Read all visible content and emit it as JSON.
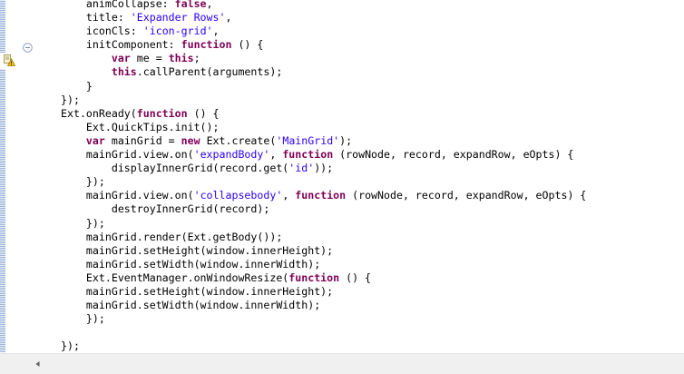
{
  "editor": {
    "lines": [
      [
        {
          "t": "    animCollapse: "
        },
        {
          "t": "false",
          "c": "kw"
        },
        {
          "t": ","
        }
      ],
      [
        {
          "t": "    title: "
        },
        {
          "t": "'Expander Rows'",
          "c": "str"
        },
        {
          "t": ","
        }
      ],
      [
        {
          "t": "    iconCls: "
        },
        {
          "t": "'icon-grid'",
          "c": "str"
        },
        {
          "t": ","
        }
      ],
      [
        {
          "t": "    initComponent: "
        },
        {
          "t": "function",
          "c": "kw"
        },
        {
          "t": " () {"
        }
      ],
      [
        {
          "t": "        "
        },
        {
          "t": "var",
          "c": "kw"
        },
        {
          "t": " me = "
        },
        {
          "t": "this",
          "c": "kw"
        },
        {
          "t": ";"
        }
      ],
      [
        {
          "t": "        "
        },
        {
          "t": "this",
          "c": "kw"
        },
        {
          "t": ".callParent(arguments);"
        }
      ],
      [
        {
          "t": "    }"
        }
      ],
      [
        {
          "t": "});"
        }
      ],
      [
        {
          "t": "Ext.onReady("
        },
        {
          "t": "function",
          "c": "kw"
        },
        {
          "t": " () {"
        }
      ],
      [
        {
          "t": "    Ext.QuickTips.init();"
        }
      ],
      [
        {
          "t": "    "
        },
        {
          "t": "var",
          "c": "kw"
        },
        {
          "t": " mainGrid = "
        },
        {
          "t": "new",
          "c": "kw"
        },
        {
          "t": " Ext.create("
        },
        {
          "t": "'MainGrid'",
          "c": "str"
        },
        {
          "t": ");"
        }
      ],
      [
        {
          "t": "    mainGrid.view.on("
        },
        {
          "t": "'expandBody'",
          "c": "str"
        },
        {
          "t": ", "
        },
        {
          "t": "function",
          "c": "kw"
        },
        {
          "t": " (rowNode, record, expandRow, eOpts) {"
        }
      ],
      [
        {
          "t": "        displayInnerGrid(record.get("
        },
        {
          "t": "'id'",
          "c": "str"
        },
        {
          "t": "));"
        }
      ],
      [
        {
          "t": "    });"
        }
      ],
      [
        {
          "t": "    mainGrid.view.on("
        },
        {
          "t": "'collapsebody'",
          "c": "str"
        },
        {
          "t": ", "
        },
        {
          "t": "function",
          "c": "kw"
        },
        {
          "t": " (rowNode, record, expandRow, eOpts) {"
        }
      ],
      [
        {
          "t": "        destroyInnerGrid(record);"
        }
      ],
      [
        {
          "t": "    });"
        }
      ],
      [
        {
          "t": "    mainGrid.render(Ext.getBody());"
        }
      ],
      [
        {
          "t": "    mainGrid.setHeight(window.innerHeight);"
        }
      ],
      [
        {
          "t": "    mainGrid.setWidth(window.innerWidth);"
        }
      ],
      [
        {
          "t": "    Ext.EventManager.onWindowResize("
        },
        {
          "t": "function",
          "c": "kw"
        },
        {
          "t": " () {"
        }
      ],
      [
        {
          "t": "    mainGrid.setHeight(window.innerHeight);"
        }
      ],
      [
        {
          "t": "    mainGrid.setWidth(window.innerWidth);"
        }
      ],
      [
        {
          "t": "    });"
        }
      ],
      [
        {
          "t": ""
        }
      ],
      [
        {
          "t": "});"
        }
      ]
    ]
  },
  "icons": {
    "warning": "warning-icon",
    "fold": "fold-collapse-icon",
    "scroll_left": "scroll-left-arrow-icon"
  },
  "colors": {
    "keyword": "#7f0055",
    "string": "#2a00ff",
    "plain": "#000000"
  }
}
